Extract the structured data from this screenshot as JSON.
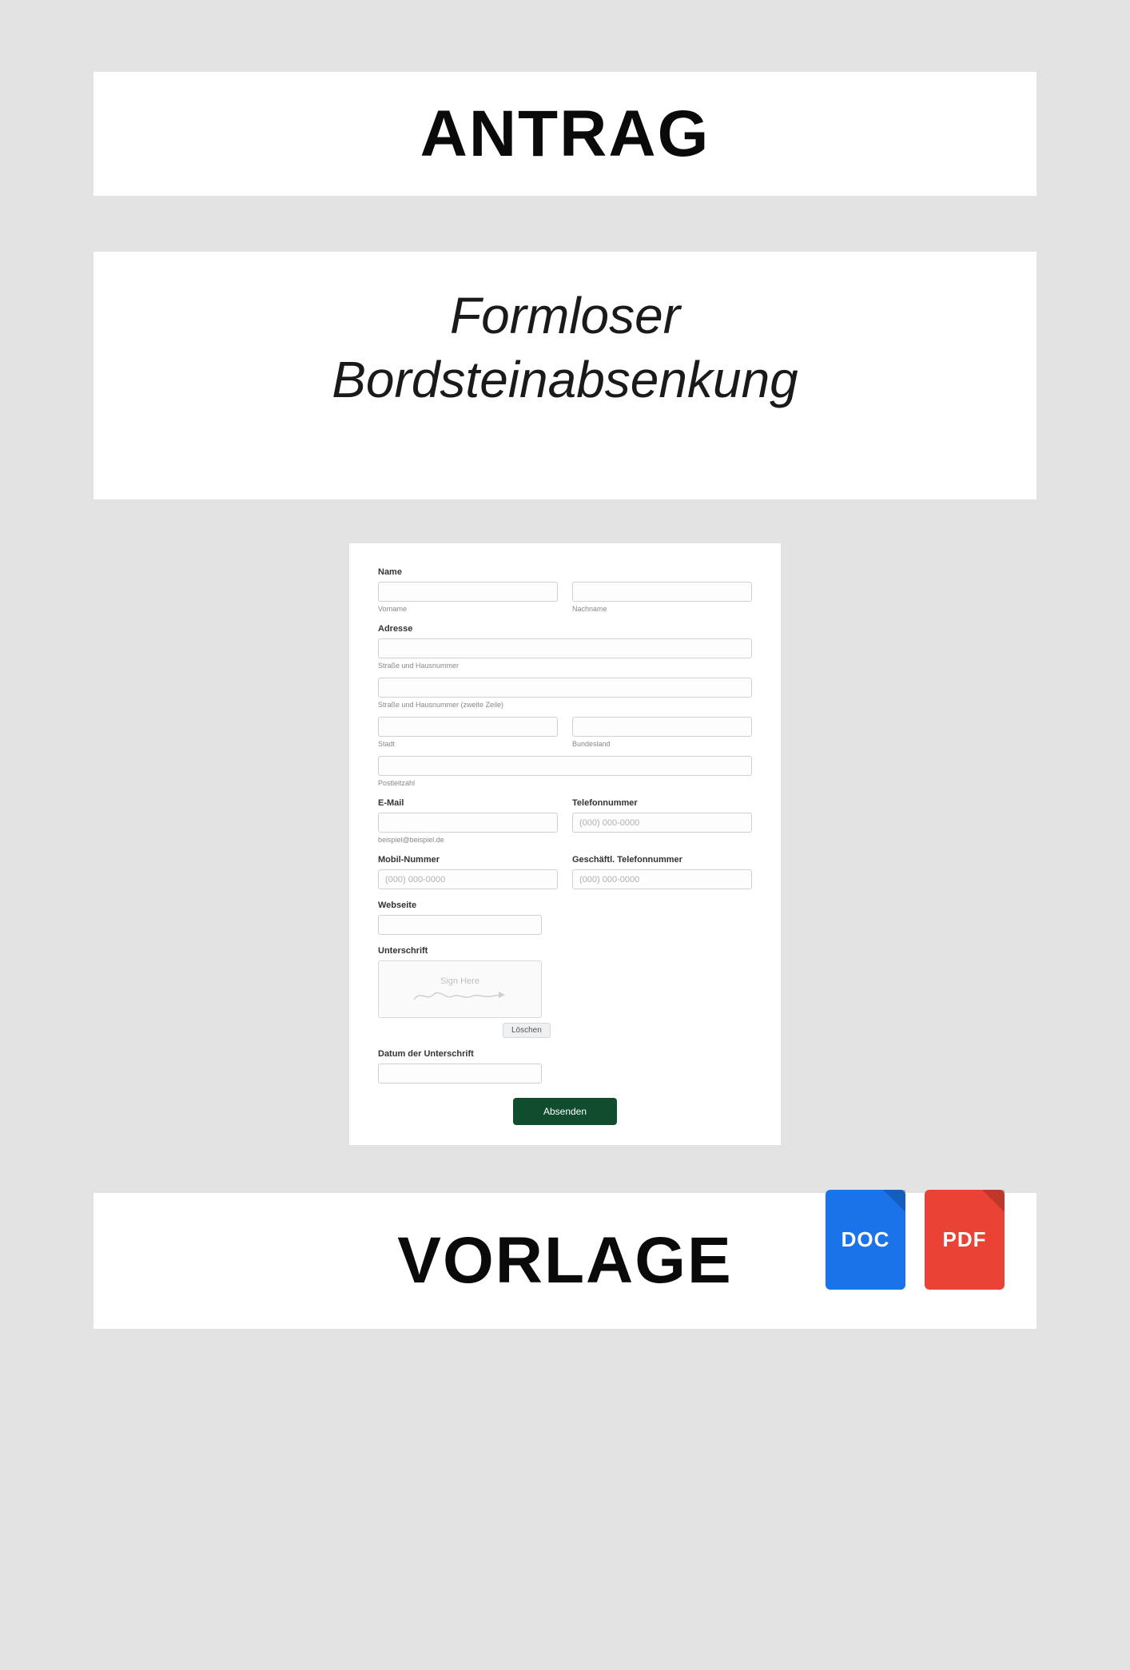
{
  "header": {
    "title": "ANTRAG"
  },
  "subtitle": {
    "line1": "Formloser",
    "line2": "Bordsteinabsenkung"
  },
  "form": {
    "name": {
      "label": "Name",
      "first_sub": "Vorname",
      "last_sub": "Nachname"
    },
    "address": {
      "label": "Adresse",
      "street1_sub": "Straße und Hausnummer",
      "street2_sub": "Straße und Hausnummer (zweite Zeile)",
      "city_sub": "Stadt",
      "state_sub": "Bundesland",
      "postal_sub": "Postleitzahl"
    },
    "email": {
      "label": "E-Mail",
      "example": "beispiel@beispiel.de"
    },
    "phone": {
      "label": "Telefonnummer",
      "placeholder": "(000) 000-0000"
    },
    "mobile": {
      "label": "Mobil-Nummer",
      "placeholder": "(000) 000-0000"
    },
    "workphone": {
      "label": "Geschäftl. Telefonnummer",
      "placeholder": "(000) 000-0000"
    },
    "website": {
      "label": "Webseite"
    },
    "signature": {
      "label": "Unterschrift",
      "sign_here": "Sign Here",
      "clear": "Löschen"
    },
    "sigdate": {
      "label": "Datum der Unterschrift"
    },
    "submit": "Absenden"
  },
  "footer": {
    "title": "VORLAGE"
  },
  "files": {
    "doc": "DOC",
    "pdf": "PDF"
  }
}
